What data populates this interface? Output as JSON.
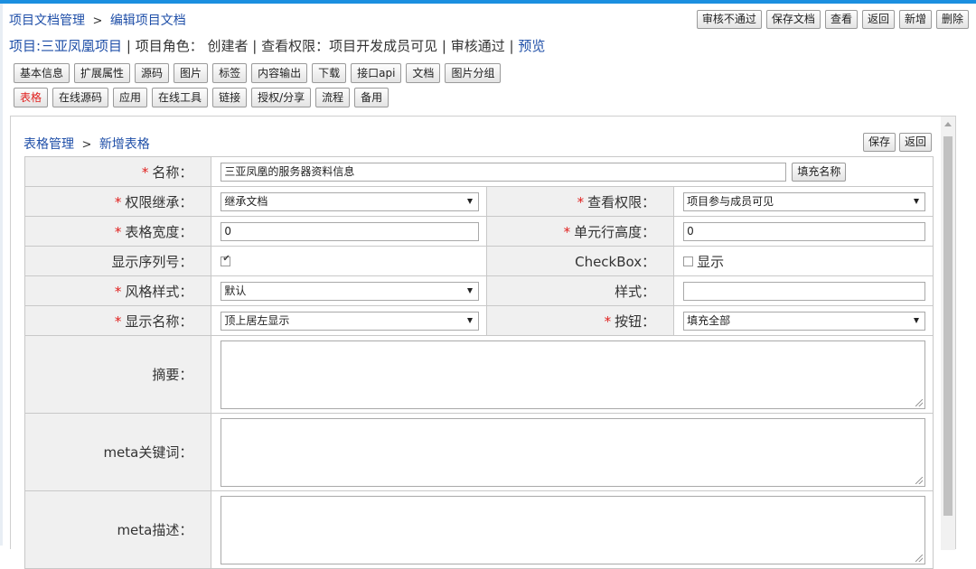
{
  "breadcrumb": {
    "root": "项目文档管理",
    "sep": ">",
    "current": "编辑项目文档"
  },
  "top_buttons": [
    "审核不通过",
    "保存文档",
    "查看",
    "返回",
    "新增",
    "删除"
  ],
  "project_line": {
    "project": "项目:三亚凤凰项目",
    "role": "项目角色： 创建者",
    "permission": "查看权限：项目开发成员可见",
    "audit": "审核通过",
    "preview": "预览",
    "divider": "|"
  },
  "tabs_row1": [
    "基本信息",
    "扩展属性",
    "源码",
    "图片",
    "标签",
    "内容输出",
    "下载",
    "接口api",
    "文档",
    "图片分组"
  ],
  "tabs_row2": [
    "表格",
    "在线源码",
    "应用",
    "在线工具",
    "链接",
    "授权/分享",
    "流程",
    "备用"
  ],
  "active_tab": "表格",
  "panel": {
    "breadcrumb_root": "表格管理",
    "breadcrumb_sep": ">",
    "breadcrumb_current": "新增表格",
    "buttons": [
      "保存",
      "返回"
    ]
  },
  "form": {
    "required_mark": "*",
    "name_label": "名称：",
    "name_value": "三亚凤凰的服务器资料信息",
    "fill_name_button": "填充名称",
    "inherit_label": "权限继承：",
    "inherit_value": "继承文档",
    "view_perm_label": "查看权限：",
    "view_perm_value": "项目参与成员可见",
    "width_label": "表格宽度：",
    "width_value": "0",
    "row_height_label": "单元行高度：",
    "row_height_value": "0",
    "show_seq_label": "显示序列号：",
    "show_seq_checked": true,
    "checkbox_label": "CheckBox：",
    "checkbox_show_text": "显示",
    "checkbox_show_checked": false,
    "style_label": "风格样式：",
    "style_value": "默认",
    "css_label": "样式：",
    "css_value": "",
    "display_name_label": "显示名称：",
    "display_name_value": "顶上居左显示",
    "button_label": "按钮：",
    "button_value": "填充全部",
    "summary_label": "摘要：",
    "meta_keywords_label": "meta关键词：",
    "meta_desc_label": "meta描述："
  }
}
